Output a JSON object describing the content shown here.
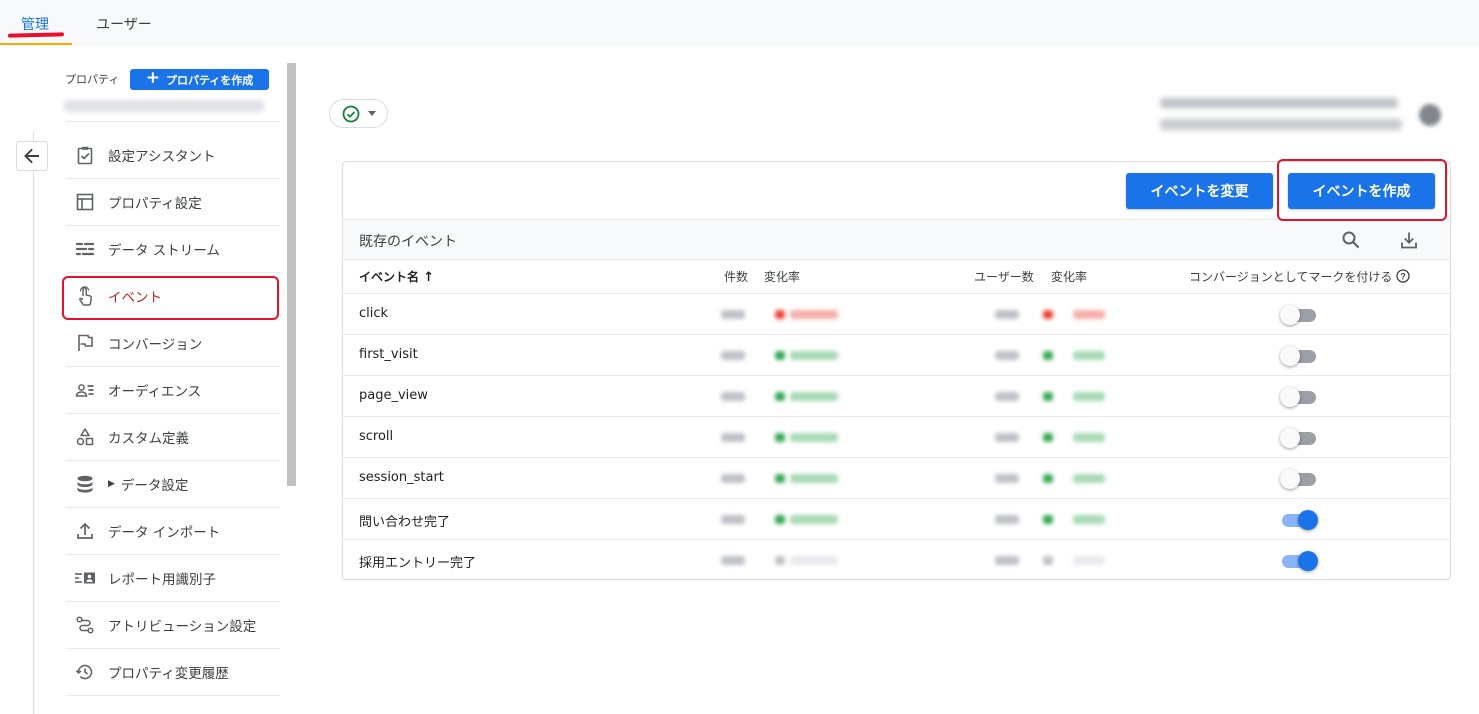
{
  "tabs": [
    {
      "label": "管理",
      "active": true
    },
    {
      "label": "ユーザー",
      "active": false
    }
  ],
  "sidebar": {
    "property_label": "プロパティ",
    "create_property_label": "プロパティを作成",
    "items": [
      {
        "label": "設定アシスタント",
        "icon": "clipboard-check-icon"
      },
      {
        "label": "プロパティ設定",
        "icon": "layout-icon"
      },
      {
        "label": "データ ストリーム",
        "icon": "streams-icon"
      },
      {
        "label": "イベント",
        "icon": "touch-icon",
        "active": true
      },
      {
        "label": "コンバージョン",
        "icon": "flag-icon"
      },
      {
        "label": "オーディエンス",
        "icon": "audience-icon"
      },
      {
        "label": "カスタム定義",
        "icon": "shapes-icon"
      },
      {
        "label": "データ設定",
        "icon": "database-icon",
        "expandable": true
      },
      {
        "label": "データ インポート",
        "icon": "upload-icon"
      },
      {
        "label": "レポート用識別子",
        "icon": "identity-icon"
      },
      {
        "label": "アトリビューション設定",
        "icon": "attribution-icon"
      },
      {
        "label": "プロパティ変更履歴",
        "icon": "history-icon"
      }
    ]
  },
  "header": {
    "status_icon": "check-circle-icon",
    "status_color": "#188038"
  },
  "events_panel": {
    "modify_button": "イベントを変更",
    "create_button": "イベントを作成",
    "existing_title": "既存のイベント",
    "columns": {
      "name": "イベント名",
      "count": "件数",
      "count_change": "変化率",
      "users": "ユーザー数",
      "users_change": "変化率",
      "conversion": "コンバージョンとしてマークを付ける"
    },
    "sort": "ascending",
    "rows": [
      {
        "name": "click",
        "conversion": false,
        "trend": "down"
      },
      {
        "name": "first_visit",
        "conversion": false,
        "trend": "up"
      },
      {
        "name": "page_view",
        "conversion": false,
        "trend": "up"
      },
      {
        "name": "scroll",
        "conversion": false,
        "trend": "up"
      },
      {
        "name": "session_start",
        "conversion": false,
        "trend": "up"
      },
      {
        "name": "問い合わせ完了",
        "conversion": true,
        "trend": "up"
      },
      {
        "name": "採用エントリー完了",
        "conversion": true,
        "trend": "none"
      }
    ]
  },
  "colors": {
    "primary": "#1a73e8",
    "highlight": "#e8112d",
    "trend_up": "#34a853",
    "trend_down": "#ea4335"
  }
}
